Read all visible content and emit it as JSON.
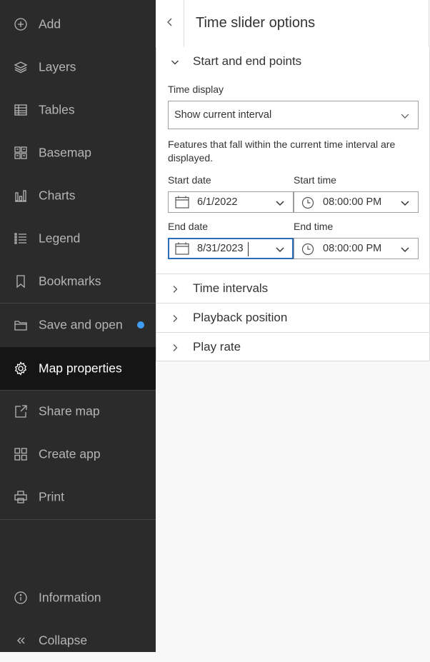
{
  "sidebar": {
    "items": [
      {
        "label": "Add",
        "icon": "plus-circle-icon"
      },
      {
        "label": "Layers",
        "icon": "layers-icon"
      },
      {
        "label": "Tables",
        "icon": "table-icon"
      },
      {
        "label": "Basemap",
        "icon": "basemap-icon"
      },
      {
        "label": "Charts",
        "icon": "chart-icon"
      },
      {
        "label": "Legend",
        "icon": "legend-icon"
      },
      {
        "label": "Bookmarks",
        "icon": "bookmark-icon"
      },
      {
        "label": "Save and open",
        "icon": "folder-icon"
      },
      {
        "label": "Map properties",
        "icon": "gear-icon"
      },
      {
        "label": "Share map",
        "icon": "share-icon"
      },
      {
        "label": "Create app",
        "icon": "grid-icon"
      },
      {
        "label": "Print",
        "icon": "printer-icon"
      }
    ],
    "bottom": [
      {
        "label": "Information",
        "icon": "info-icon"
      },
      {
        "label": "Collapse",
        "icon": "double-chevron-left-icon"
      }
    ],
    "active_index": 8,
    "accent_color": "#3f9df2"
  },
  "panel": {
    "title": "Time slider options",
    "sections": [
      {
        "title": "Start and end points",
        "expanded": true
      },
      {
        "title": "Time intervals",
        "expanded": false
      },
      {
        "title": "Playback position",
        "expanded": false
      },
      {
        "title": "Play rate",
        "expanded": false
      }
    ],
    "time_display": {
      "label": "Time display",
      "value": "Show current interval"
    },
    "description": "Features that fall within the current time interval are displayed.",
    "start_date": {
      "label": "Start date",
      "value": "6/1/2022"
    },
    "start_time": {
      "label": "Start time",
      "value": "08:00:00 PM"
    },
    "end_date": {
      "label": "End date",
      "value": "8/31/2023"
    },
    "end_time": {
      "label": "End time",
      "value": "08:00:00 PM"
    }
  }
}
